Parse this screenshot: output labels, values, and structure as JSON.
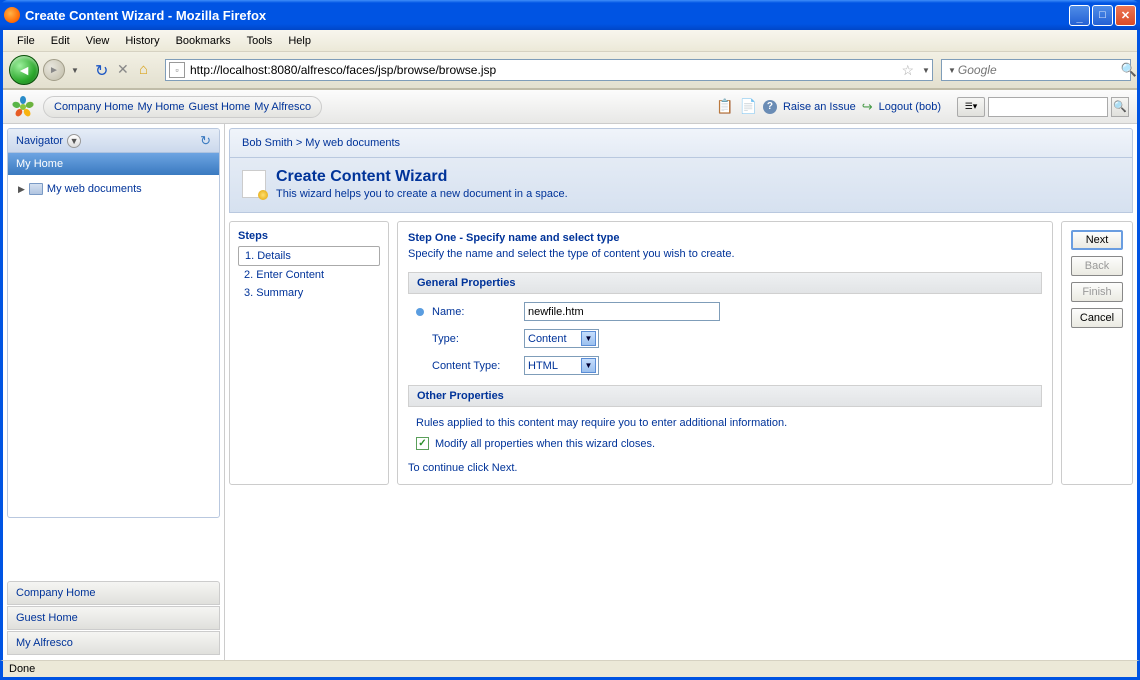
{
  "window": {
    "title": "Create Content Wizard - Mozilla Firefox"
  },
  "browser": {
    "menus": {
      "file": "File",
      "edit": "Edit",
      "view": "View",
      "history": "History",
      "bookmarks": "Bookmarks",
      "tools": "Tools",
      "help": "Help"
    },
    "address": "http://localhost:8080/alfresco/faces/jsp/browse/browse.jsp",
    "search_placeholder": "Google",
    "status": "Done"
  },
  "alfresco_nav": {
    "company_home": "Company Home",
    "my_home": "My Home",
    "guest_home": "Guest Home",
    "my_alfresco": "My Alfresco",
    "raise_issue": "Raise an Issue",
    "logout": "Logout (bob)"
  },
  "sidebar": {
    "title": "Navigator",
    "selected": "My Home",
    "tree_item": "My web documents",
    "bottom": [
      "Company Home",
      "Guest Home",
      "My Alfresco"
    ]
  },
  "breadcrumb": {
    "root": "Bob Smith",
    "current": "My web documents"
  },
  "wizard": {
    "title": "Create Content Wizard",
    "subtitle": "This wizard helps you to create a new document in a space.",
    "steps_label": "Steps",
    "steps": [
      "1. Details",
      "2. Enter Content",
      "3. Summary"
    ],
    "step_heading": "Step One - Specify name and select type",
    "step_desc": "Specify the name and select the type of content you wish to create.",
    "general_props": "General Properties",
    "name_label": "Name:",
    "name_value": "newfile.htm",
    "type_label": "Type:",
    "type_value": "Content",
    "ctype_label": "Content Type:",
    "ctype_value": "HTML",
    "other_props": "Other Properties",
    "rules_text": "Rules applied to this content may require you to enter additional information.",
    "modify_label": "Modify all properties when this wizard closes.",
    "continue": "To continue click Next.",
    "buttons": {
      "next": "Next",
      "back": "Back",
      "finish": "Finish",
      "cancel": "Cancel"
    }
  }
}
